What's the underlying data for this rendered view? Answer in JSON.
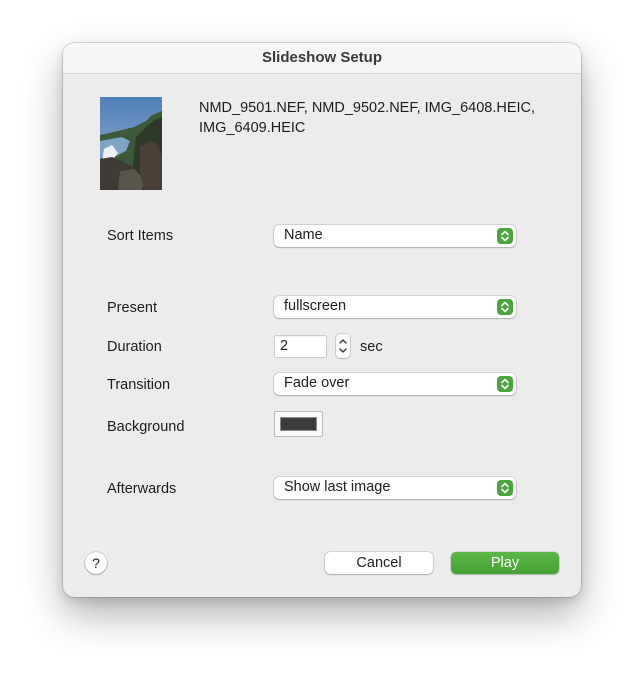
{
  "window": {
    "title": "Slideshow Setup"
  },
  "selection": {
    "thumbnail_icon": "photo-thumbnail",
    "files_line1": "NMD_9501.NEF, NMD_9502.NEF, IMG_6408.HEIC,",
    "files_line2": "IMG_6409.HEIC"
  },
  "form": {
    "sort_items": {
      "label": "Sort Items",
      "value": "Name"
    },
    "present": {
      "label": "Present",
      "value": "fullscreen"
    },
    "duration": {
      "label": "Duration",
      "value": "2",
      "unit": "sec"
    },
    "transition": {
      "label": "Transition",
      "value": "Fade over"
    },
    "background": {
      "label": "Background",
      "color": "#3c3c3c"
    },
    "afterwards": {
      "label": "Afterwards",
      "value": "Show last image"
    }
  },
  "buttons": {
    "help": "?",
    "cancel": "Cancel",
    "play": "Play"
  },
  "colors": {
    "accent": "#4aa53a",
    "window_bg": "#ececec"
  }
}
